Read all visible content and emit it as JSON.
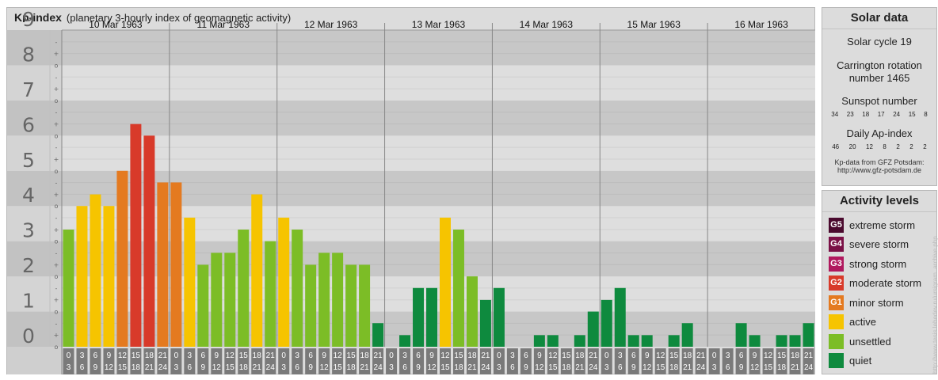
{
  "header": {
    "title": "Kp-index",
    "subtitle": "(planetary 3-hourly index of geomagnetic activity)"
  },
  "solar_data": {
    "title": "Solar data",
    "solar_cycle": "Solar cycle 19",
    "carrington_line1": "Carrington rotation",
    "carrington_line2": "number 1465",
    "sunspot_title": "Sunspot number",
    "sunspot_values": [
      "34",
      "23",
      "18",
      "17",
      "24",
      "15",
      "8"
    ],
    "ap_title": "Daily Ap-index",
    "ap_values": [
      "46",
      "20",
      "12",
      "8",
      "2",
      "2",
      "2"
    ],
    "source_line1": "Kp-data from GFZ Potsdam:",
    "source_line2": "http://www.gfz-potsdam.de"
  },
  "activity_levels": {
    "title": "Activity levels",
    "items": [
      {
        "code": "G5",
        "label": "extreme storm",
        "color": "#4a0a2e"
      },
      {
        "code": "G4",
        "label": "severe storm",
        "color": "#7a1046"
      },
      {
        "code": "G3",
        "label": "strong storm",
        "color": "#b0185e"
      },
      {
        "code": "G2",
        "label": "moderate storm",
        "color": "#d83a2a"
      },
      {
        "code": "G1",
        "label": "minor storm",
        "color": "#e47a20"
      },
      {
        "code": "",
        "label": "active",
        "color": "#f6c400"
      },
      {
        "code": "",
        "label": "unsettled",
        "color": "#7cbd26"
      },
      {
        "code": "",
        "label": "quiet",
        "color": "#0e8a3e"
      }
    ]
  },
  "credit": "http://www.tesis.lebedev.ru/ursigram_archive.php",
  "chart_data": {
    "type": "bar",
    "title": "Kp-index",
    "ylim": [
      0,
      9
    ],
    "y_ticks": [
      "0",
      "1",
      "2",
      "3",
      "4",
      "5",
      "6",
      "7",
      "8",
      "9"
    ],
    "minor_tick_labels": [
      "o",
      "+",
      "-"
    ],
    "days": [
      "10 Mar 1963",
      "11 Mar 1963",
      "12 Mar 1963",
      "13 Mar 1963",
      "14 Mar 1963",
      "15 Mar 1963",
      "16 Mar 1963"
    ],
    "interval_starts": [
      "0",
      "3",
      "6",
      "9",
      "12",
      "15",
      "18",
      "21"
    ],
    "interval_ends": [
      "3",
      "6",
      "9",
      "12",
      "15",
      "18",
      "21",
      "24"
    ],
    "values": [
      [
        3.33,
        4.0,
        4.33,
        4.0,
        5.0,
        6.33,
        6.0,
        4.67
      ],
      [
        4.67,
        3.67,
        2.33,
        2.67,
        2.67,
        3.33,
        4.33,
        3.0
      ],
      [
        3.67,
        3.33,
        2.33,
        2.67,
        2.67,
        2.33,
        2.33,
        0.67
      ],
      [
        0.0,
        0.33,
        1.67,
        1.67,
        3.67,
        3.33,
        2.0,
        1.33
      ],
      [
        1.67,
        0.0,
        0.0,
        0.33,
        0.33,
        0.0,
        0.33,
        1.0
      ],
      [
        1.33,
        1.67,
        0.33,
        0.33,
        0.0,
        0.33,
        0.67,
        0.0
      ],
      [
        0.0,
        0.0,
        0.67,
        0.33,
        0.0,
        0.33,
        0.33,
        0.67
      ]
    ],
    "level_colors": {
      "quiet": "#0e8a3e",
      "unsettled": "#7cbd26",
      "active": "#f6c400",
      "minor_storm": "#e47a20",
      "moderate_storm": "#d83a2a"
    },
    "grid": true
  }
}
